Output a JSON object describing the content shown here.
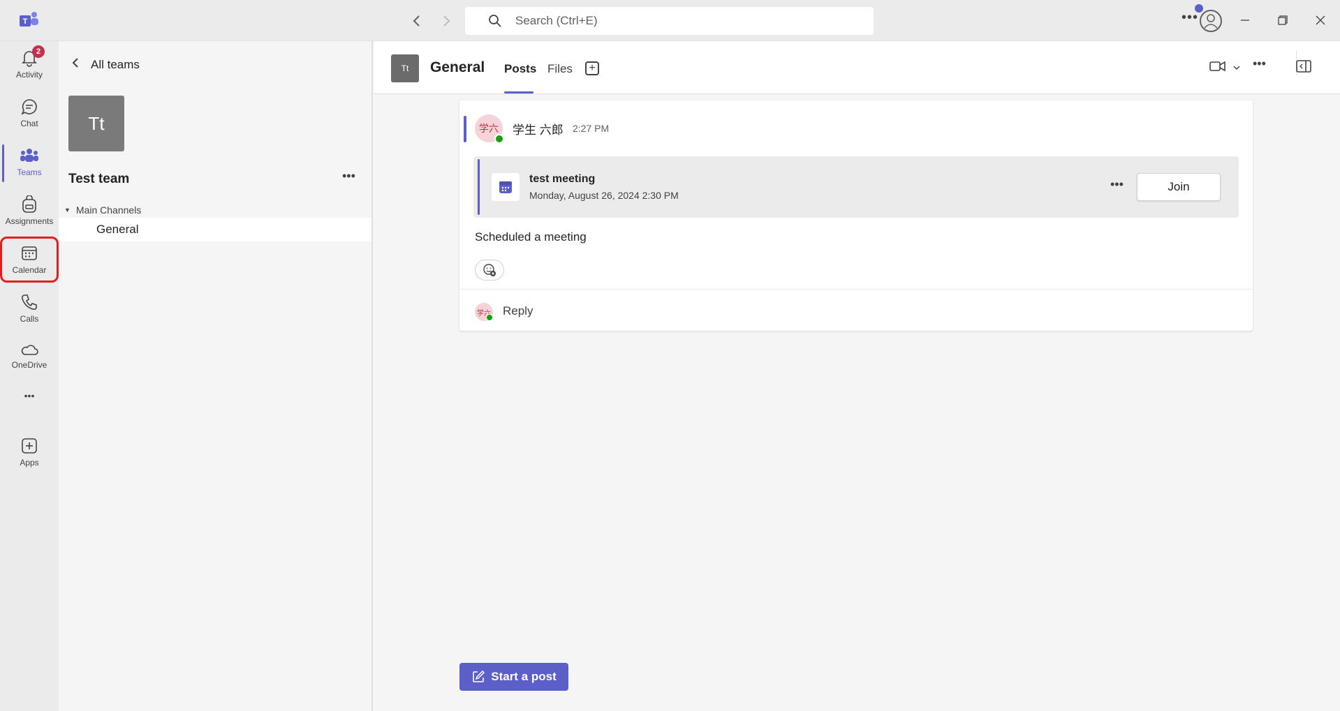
{
  "titlebar": {
    "search_placeholder": "Search (Ctrl+E)"
  },
  "rail": {
    "items": [
      {
        "label": "Activity",
        "badge": "2"
      },
      {
        "label": "Chat"
      },
      {
        "label": "Teams"
      },
      {
        "label": "Assignments"
      },
      {
        "label": "Calendar"
      },
      {
        "label": "Calls"
      },
      {
        "label": "OneDrive"
      },
      {
        "label": "Apps"
      }
    ],
    "more_label": "•••"
  },
  "teampanel": {
    "back_label": "All teams",
    "avatar_initials": "Tt",
    "team_name": "Test team",
    "more_label": "•••",
    "section_label": "Main Channels",
    "channels": [
      "General"
    ]
  },
  "main": {
    "avatar_initials": "Tt",
    "channel_title": "General",
    "tabs": [
      {
        "label": "Posts",
        "active": true
      },
      {
        "label": "Files",
        "active": false
      }
    ],
    "add_tab_label": "+",
    "more_label": "•••"
  },
  "post": {
    "author_initials": "学六",
    "author_name": "学生 六郎",
    "time": "2:27 PM",
    "meeting_title": "test meeting",
    "meeting_datetime": "Monday, August 26, 2024 2:30 PM",
    "meeting_more": "•••",
    "join_label": "Join",
    "body": "Scheduled a meeting",
    "reply_initials": "学六",
    "reply_label": "Reply"
  },
  "compose": {
    "start_post_label": "Start a post"
  },
  "colors": {
    "accent": "#5b5fc7",
    "badge": "#c4314b",
    "presence": "#13a10e",
    "highlight": "#e02020"
  }
}
